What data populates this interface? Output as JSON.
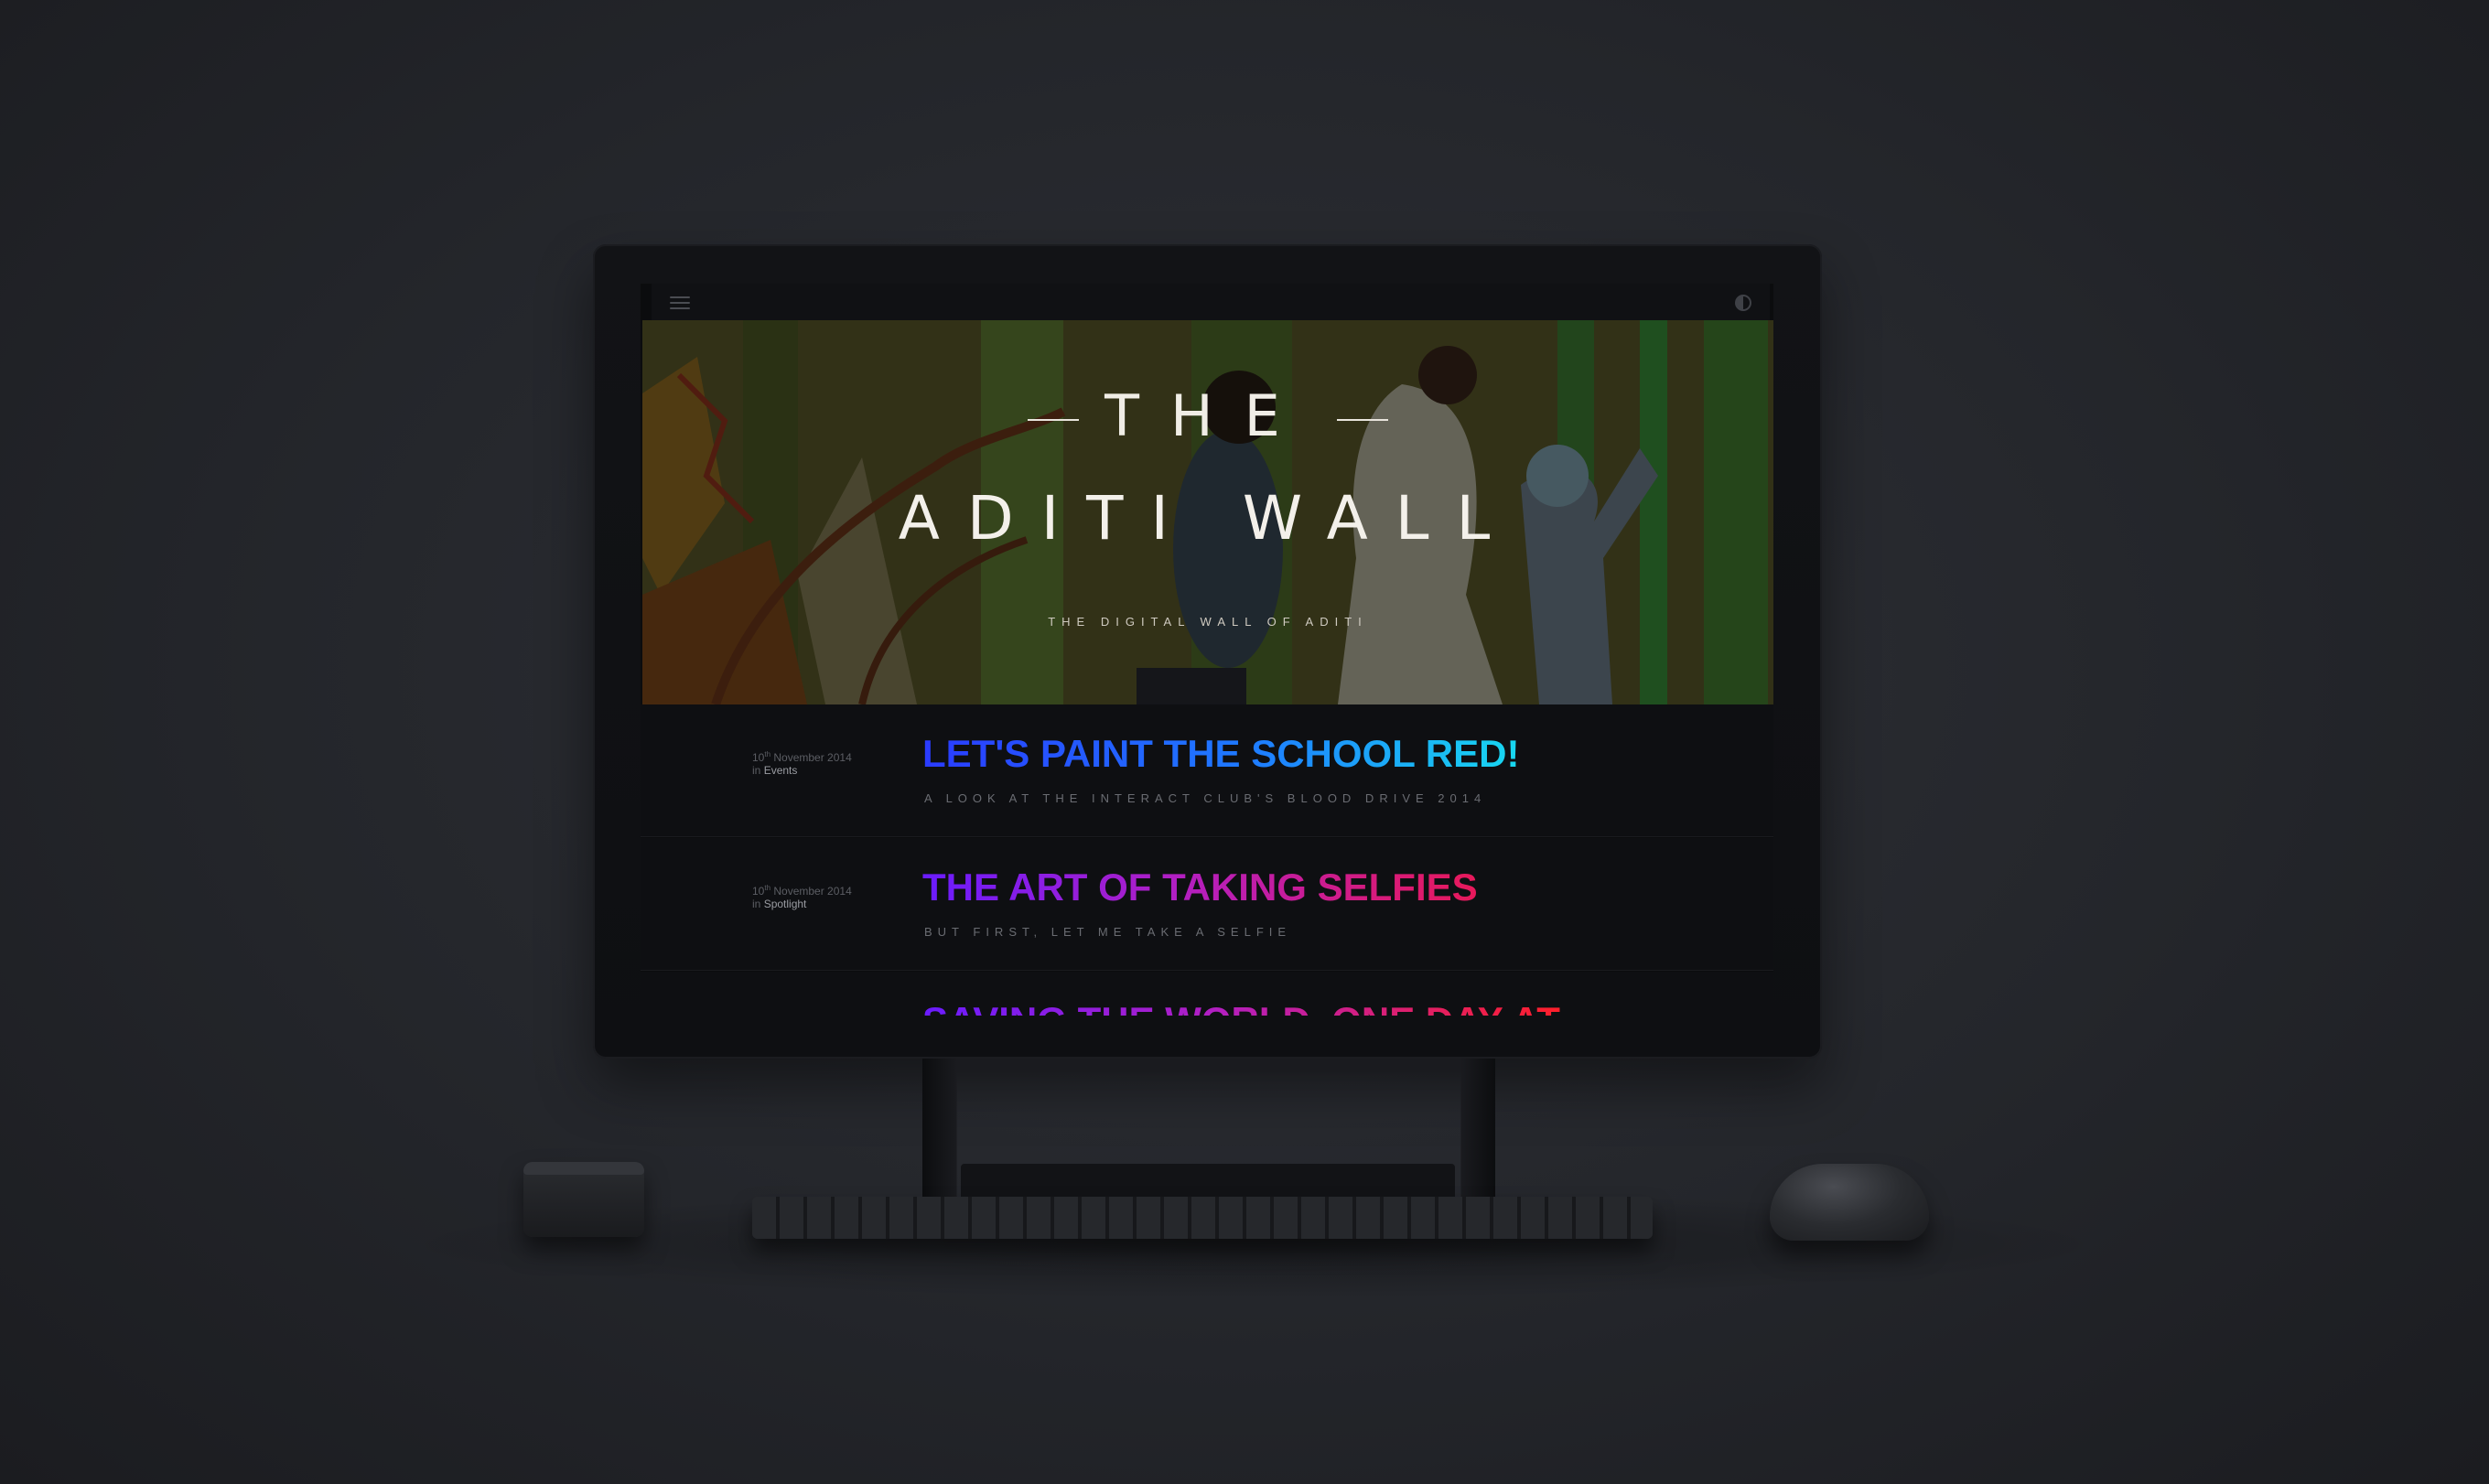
{
  "hero": {
    "kicker": "THE",
    "title": "ADITI WALL",
    "subtitle": "THE DIGITAL WALL OF ADITI"
  },
  "topbar": {
    "menu_icon": "hamburger-menu-icon",
    "contrast_icon": "contrast-toggle-icon"
  },
  "posts": [
    {
      "date_day": "10",
      "date_suffix": "th",
      "date_rest": " November 2014",
      "in_label": "in ",
      "category": "Events",
      "title": "LET'S PAINT THE SCHOOL RED!",
      "subtitle": "A LOOK AT THE INTERACT CLUB'S BLOOD DRIVE 2014"
    },
    {
      "date_day": "10",
      "date_suffix": "th",
      "date_rest": " November 2014",
      "in_label": "in ",
      "category": "Spotlight",
      "title": "THE ART OF TAKING SELFIES",
      "subtitle": "BUT FIRST, LET ME TAKE A SELFIE"
    },
    {
      "title": "SAVING THE WORLD, ONE DAY AT"
    }
  ],
  "colors": {
    "background": "#24262b",
    "screen": "#0e0f12",
    "post1_gradient": [
      "#2a3bff",
      "#18d8f0"
    ],
    "post2_gradient": [
      "#6a1cff",
      "#e8195a"
    ]
  }
}
